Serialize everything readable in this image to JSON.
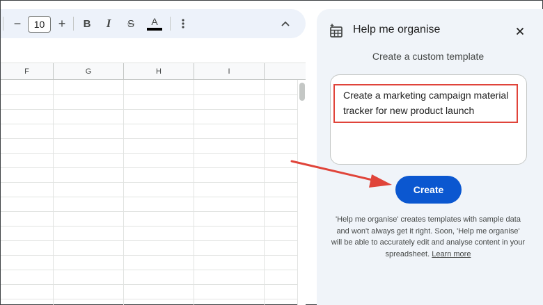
{
  "toolbar": {
    "font_size": "10",
    "decrease_symbol": "−",
    "increase_symbol": "+",
    "bold_label": "B",
    "italic_label": "I",
    "strikethrough_label": "S",
    "text_color_label": "A",
    "icons": [
      "minus-icon",
      "plus-icon",
      "bold-icon",
      "italic-icon",
      "strikethrough-icon",
      "text-color-icon",
      "more-vert-icon",
      "chevron-up-icon"
    ]
  },
  "grid": {
    "columns": [
      "F",
      "G",
      "H",
      "I"
    ]
  },
  "panel": {
    "title": "Help me organise",
    "subtitle": "Create a custom template",
    "prompt_text": "Create a marketing campaign material tracker for new product launch",
    "create_label": "Create",
    "disclaimer": "'Help me organise' creates templates with sample data and won't always get it right. Soon, 'Help me organise' will be able to accurately edit and analyse content in your spreadsheet.",
    "learn_more": "Learn more",
    "icons": [
      "table-sparkle-icon",
      "close-icon"
    ]
  },
  "colors": {
    "primary_blue": "#0b57d0",
    "annotation_red": "#e0443a",
    "panel_bg": "#f0f4f9",
    "toolbar_bg": "#edf2fa",
    "text_color_underline": "#000000"
  }
}
